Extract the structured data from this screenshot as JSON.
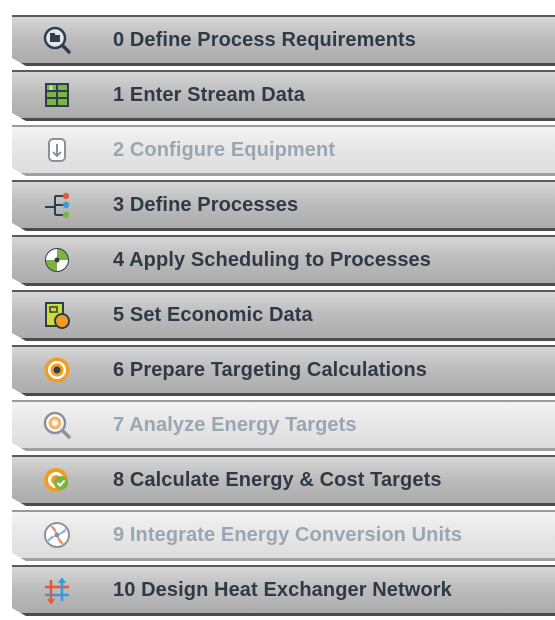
{
  "steps": [
    {
      "label": "0 Define Process Requirements",
      "icon": "magnifier-folder-icon",
      "enabled": true
    },
    {
      "label": "1 Enter Stream Data",
      "icon": "spreadsheet-icon",
      "enabled": true
    },
    {
      "label": "2 Configure Equipment",
      "icon": "vessel-icon",
      "enabled": false
    },
    {
      "label": "3 Define Processes",
      "icon": "process-tree-icon",
      "enabled": true
    },
    {
      "label": "4 Apply Scheduling to Processes",
      "icon": "schedule-pie-icon",
      "enabled": true
    },
    {
      "label": "5 Set Economic Data",
      "icon": "economic-coin-icon",
      "enabled": true
    },
    {
      "label": "6 Prepare Targeting Calculations",
      "icon": "target-icon",
      "enabled": true
    },
    {
      "label": "7 Analyze Energy Targets",
      "icon": "analyze-target-icon",
      "enabled": false
    },
    {
      "label": "8 Calculate Energy & Cost Targets",
      "icon": "target-check-icon",
      "enabled": true
    },
    {
      "label": "9 Integrate Energy Conversion Units",
      "icon": "conversion-unit-icon",
      "enabled": false
    },
    {
      "label": "10 Design Heat Exchanger Network",
      "icon": "heat-exchanger-network-icon",
      "enabled": true
    }
  ],
  "colors": {
    "enabled_text": "#2f3a46",
    "disabled_text": "#9aa6b0",
    "accent_orange": "#f39c1f",
    "accent_green": "#7cb342",
    "accent_blue": "#3a9ad9",
    "accent_red": "#e25a3c"
  }
}
